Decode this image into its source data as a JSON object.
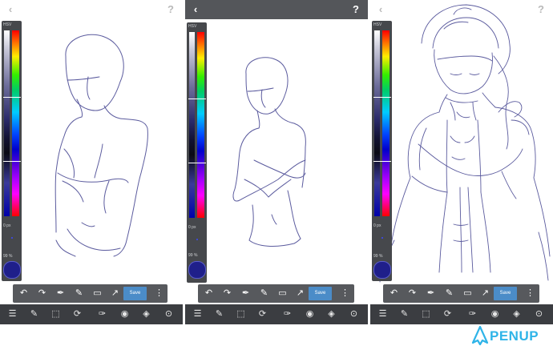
{
  "palette": {
    "mode_label": "HSV",
    "brush_size": "0 px",
    "opacity": "99 %"
  },
  "toolbar": {
    "save_label": "Save"
  },
  "brand": {
    "name": "PENUP",
    "color": "#2fb4e8"
  },
  "colors": {
    "toolbar": "#57595d",
    "bottombar": "#3b3d41",
    "save": "#4b8cc8",
    "stroke": "#5b5b9e"
  },
  "icons": {
    "top": [
      "back-icon",
      "help-icon"
    ],
    "tools": [
      "undo-icon",
      "redo-icon",
      "eyedropper-icon",
      "pencil-icon",
      "eraser-icon",
      "fill-icon",
      "grid-icon"
    ],
    "bottom": [
      "menu-icon",
      "edit-icon",
      "select-icon",
      "rotate-icon",
      "brush-icon",
      "palette-icon",
      "layers-icon",
      "more-icon"
    ]
  }
}
